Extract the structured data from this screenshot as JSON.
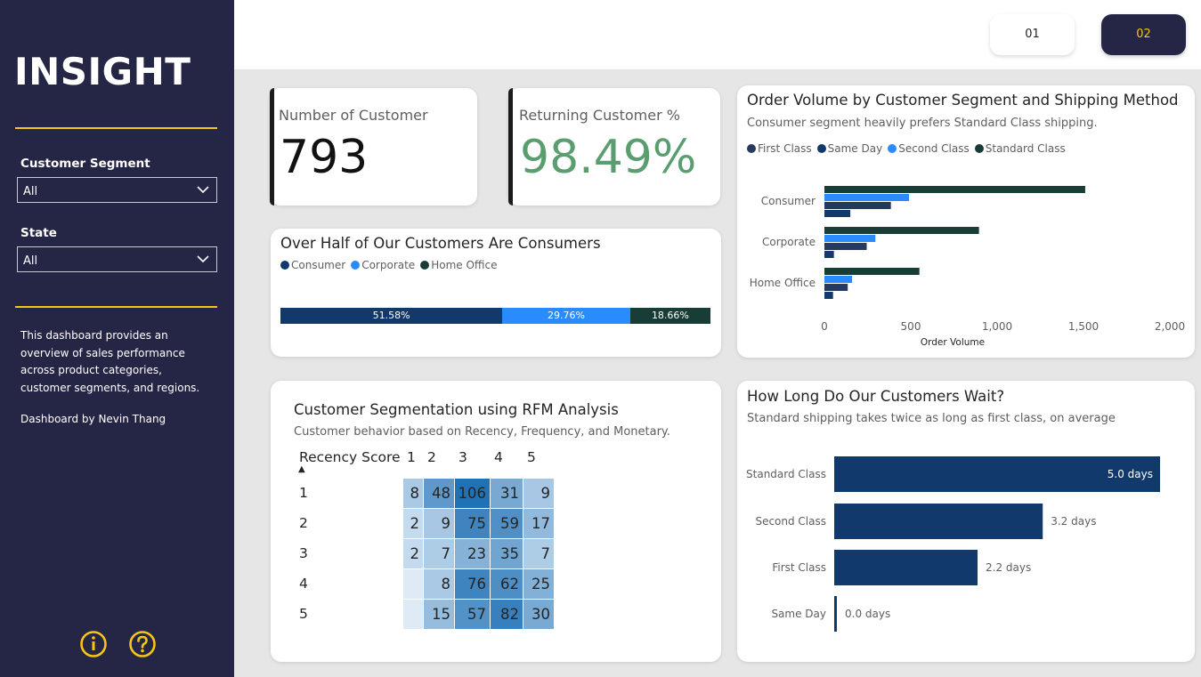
{
  "sidebar": {
    "brand": "INSIGHT",
    "filters": [
      {
        "label": "Customer Segment",
        "value": "All"
      },
      {
        "label": "State",
        "value": "All"
      }
    ],
    "description": "This dashboard provides an overview of sales performance across product categories, customer segments, and regions.",
    "byline": "Dashboard by Nevin Thang",
    "icons": [
      "info-icon",
      "help-icon"
    ],
    "accent_color": "#f5c518",
    "background_color": "#252645"
  },
  "pages": [
    {
      "label": "01",
      "active": false
    },
    {
      "label": "02",
      "active": true
    }
  ],
  "kpis": [
    {
      "label": "Number of Customer",
      "value": "793",
      "color": "#111111"
    },
    {
      "label": "Returning Customer %",
      "value": "98.49%",
      "color": "#5a9e6f"
    }
  ],
  "segment_share": {
    "title": "Over Half of Our Customers Are Consumers",
    "legend": [
      {
        "name": "Consumer",
        "color": "#12396b"
      },
      {
        "name": "Corporate",
        "color": "#2a8bff"
      },
      {
        "name": "Home Office",
        "color": "#173d36"
      }
    ],
    "segments": [
      {
        "name": "Consumer",
        "value": 51.58,
        "label": "51.58%",
        "color": "#12396b"
      },
      {
        "name": "Corporate",
        "value": 29.76,
        "label": "29.76%",
        "color": "#2a8bff"
      },
      {
        "name": "Home Office",
        "value": 18.66,
        "label": "18.66%",
        "color": "#173d36"
      }
    ]
  },
  "order_volume": {
    "title": "Order Volume by Customer Segment and Shipping Method",
    "subtitle": "Consumer segment heavily prefers Standard Class shipping."
  },
  "rfm": {
    "title": "Customer Segmentation using RFM Analysis",
    "subtitle": "Customer behavior based on Recency, Frequency, and Monetary.",
    "row_header": "Recency Score",
    "sort_indicator": "▲",
    "columns": [
      "1",
      "2",
      "3",
      "4",
      "5"
    ],
    "rows": [
      {
        "label": "1",
        "cells": [
          "8",
          "48",
          "106",
          "31",
          "9"
        ]
      },
      {
        "label": "2",
        "cells": [
          "2",
          "9",
          "75",
          "59",
          "17"
        ]
      },
      {
        "label": "3",
        "cells": [
          "2",
          "7",
          "23",
          "35",
          "7"
        ]
      },
      {
        "label": "4",
        "cells": [
          "",
          "8",
          "76",
          "62",
          "25"
        ]
      },
      {
        "label": "5",
        "cells": [
          "",
          "15",
          "57",
          "82",
          "30"
        ]
      }
    ]
  },
  "wait_time": {
    "title": "How Long Do Our Customers Wait?",
    "subtitle": "Standard shipping takes twice as long as first class, on average"
  },
  "chart_data": [
    {
      "type": "bar",
      "orientation": "horizontal",
      "categories": [
        "Consumer",
        "Corporate",
        "Home Office"
      ],
      "series": [
        {
          "name": "First Class",
          "color": "#243a5e",
          "values": [
            385,
            245,
            135
          ]
        },
        {
          "name": "Same Day",
          "color": "#12396b",
          "values": [
            150,
            55,
            50
          ]
        },
        {
          "name": "Second Class",
          "color": "#2a8bff",
          "values": [
            490,
            295,
            160
          ]
        },
        {
          "name": "Standard Class",
          "color": "#173d36",
          "values": [
            1510,
            895,
            550
          ]
        }
      ],
      "series_draw_order": [
        "Standard Class",
        "Second Class",
        "First Class",
        "Same Day"
      ],
      "xlabel": "Order Volume",
      "xticks": [
        "0",
        "500",
        "1,000",
        "1,500",
        "2,000"
      ],
      "xlim": [
        0,
        2000
      ],
      "grid": false,
      "legend_position": "top-left"
    },
    {
      "type": "bar",
      "orientation": "horizontal",
      "categories": [
        "Standard Class",
        "Second Class",
        "First Class",
        "Same Day"
      ],
      "values": [
        5.0,
        3.2,
        2.2,
        0.0
      ],
      "value_labels": [
        "5.0 days",
        "3.2 days",
        "2.2 days",
        "0.0 days"
      ],
      "color": "#12396b",
      "xlim": [
        0,
        5.0
      ],
      "grid": false
    }
  ]
}
